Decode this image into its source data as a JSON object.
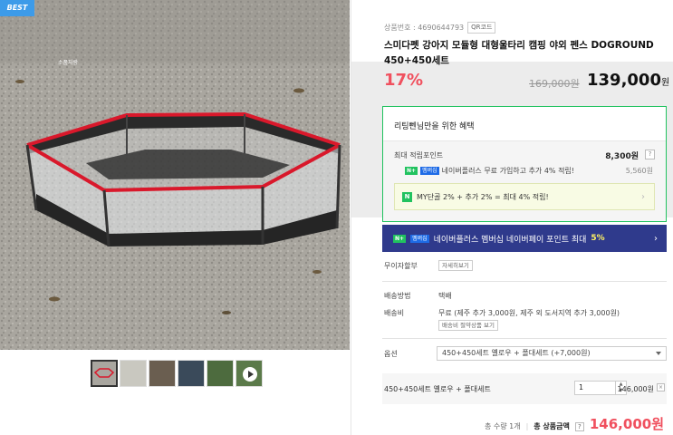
{
  "gallery": {
    "badge": "BEST",
    "watermark": "소품자랑",
    "thumbnails": [
      "fence-top-view",
      "fence-with-dog",
      "fence-parts",
      "fence-bag",
      "fence-grass",
      "video-play"
    ]
  },
  "product": {
    "code_label": "상품번호 : 4690644793",
    "qr_label": "QR코드",
    "title": "스미다펫 강아지 모듈형 대형울타리 캠핑 야외 펜스 DOGROUND 450+450세트",
    "discount": "17%",
    "original_price": "169,000원",
    "sale_price": "139,000",
    "sale_unit": "원"
  },
  "benefit": {
    "title": "리팅뻰님만을 위한 혜택",
    "points_label": "최대 적립포인트",
    "points_value": "8,300원",
    "help": "?",
    "naverplus_badge": "N+",
    "membership_badge": "멤버십",
    "naverplus_text": "네이버플러스 무료 가입하고 추가 4% 적립!",
    "naverplus_value": "5,560원",
    "my_badge": "N",
    "my_text": "MY단골 2% + 추가 2% = 최대 4% 적립!"
  },
  "banner": {
    "badge": "N+",
    "membership_badge": "멤버십",
    "text": "네이버플러스 멤버십 네이버페이 포인트 최대",
    "highlight": "5%"
  },
  "rows": {
    "interest_label": "무이자할부",
    "interest_btn": "자세히보기",
    "shipping_method_label": "배송방법",
    "shipping_method_value": "택배",
    "shipping_fee_label": "배송비",
    "shipping_fee_value": "무료 (제주 추가 3,000원, 제주 외 도서지역 추가 3,000원)",
    "shipping_btn": "배송비 절약상품 보기",
    "option_label": "옵션",
    "option_selected": "450+450세트 옐로우 + 폴대세트 (+7,000원)"
  },
  "selected_option": {
    "name": "450+450세트 옐로우 + 폴대세트",
    "quantity": "1",
    "price": "146,000원",
    "remove": "×"
  },
  "total": {
    "quantity_text": "총 수량 1개",
    "label": "총 상품금액",
    "help": "?",
    "amount": "146,000원"
  },
  "colors": {
    "naver_green": "#21c25f",
    "discount_red": "#f0505e",
    "banner_navy": "#2f3a8c",
    "best_blue": "#3d9be9"
  }
}
